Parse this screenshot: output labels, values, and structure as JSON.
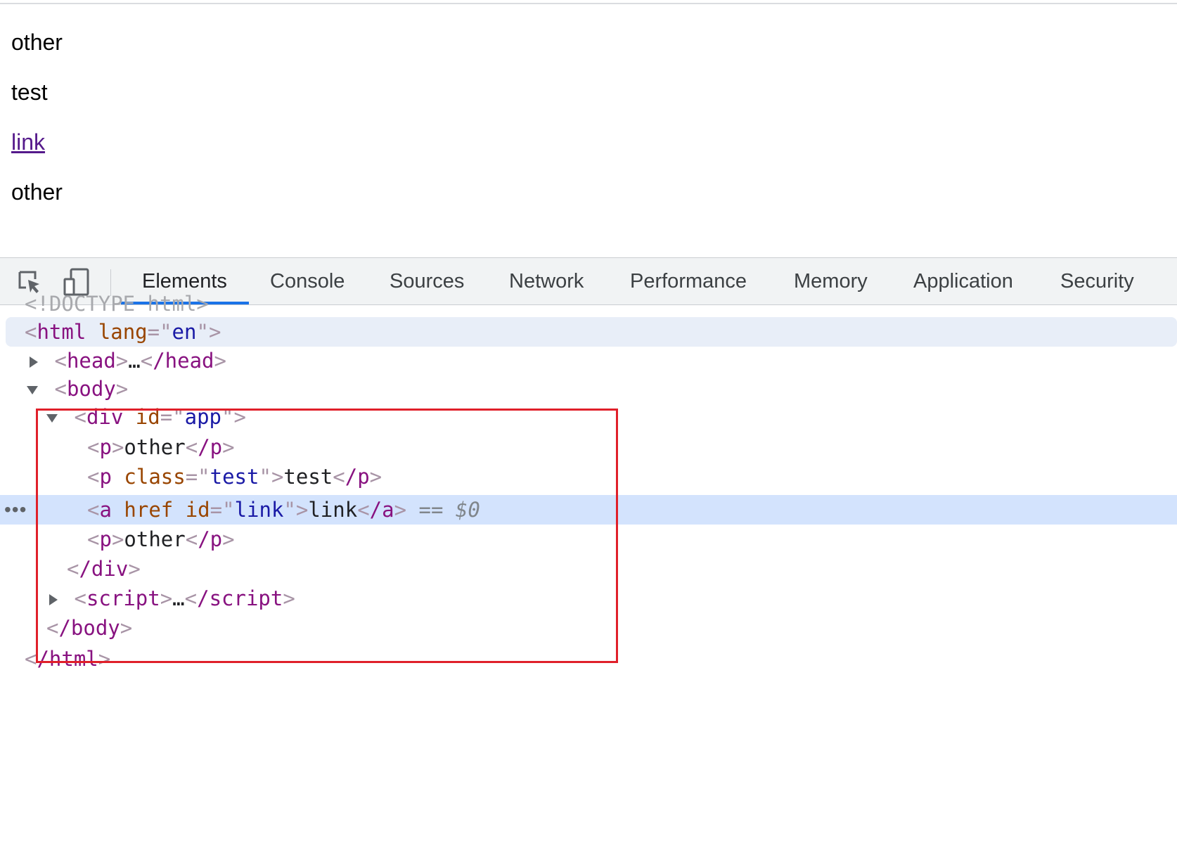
{
  "viewport": {
    "paragraph_1": "other",
    "paragraph_2": "test",
    "link": "link",
    "paragraph_3": "other"
  },
  "toolbar": {
    "tabs": [
      {
        "label": "Elements",
        "active": true
      },
      {
        "label": "Console"
      },
      {
        "label": "Sources"
      },
      {
        "label": "Network"
      },
      {
        "label": "Performance"
      },
      {
        "label": "Memory"
      },
      {
        "label": "Application"
      },
      {
        "label": "Security"
      }
    ],
    "inspect_icon": "inspect-element-icon",
    "device_icon": "device-toggle-icon"
  },
  "tree": {
    "doctype": "<!DOCTYPE html>",
    "html_open": {
      "tag": "html",
      "attr": "lang",
      "value": "en"
    },
    "head": {
      "open": "head",
      "ellipsis": "…",
      "close": "/head"
    },
    "body_open": "body",
    "div_open": {
      "tag": "div",
      "attr": "id",
      "value": "app"
    },
    "p1": {
      "tag": "p",
      "text": "other",
      "close": "/p"
    },
    "p2": {
      "tag": "p",
      "attr": "class",
      "value": "test",
      "text": "test",
      "close": "/p"
    },
    "a": {
      "tag": "a",
      "attr1": "href",
      "attr2": "id",
      "value": "link",
      "text": "link",
      "close": "/a",
      "marker_eq": "==",
      "marker_var": "$0"
    },
    "p3": {
      "tag": "p",
      "text": "other",
      "close": "/p"
    },
    "div_close": "/div",
    "script": {
      "open": "script",
      "ellipsis": "…",
      "close": "/script"
    },
    "body_close": "/body",
    "html_close": "/html",
    "row_dots": "•••"
  },
  "colors": {
    "tag": "#881280",
    "attr_name": "#994500",
    "attr_value": "#1a1aa6",
    "tab_underline": "#1a73e8",
    "selected_row": "#d3e3fd",
    "highlight_box": "#e0202a"
  }
}
